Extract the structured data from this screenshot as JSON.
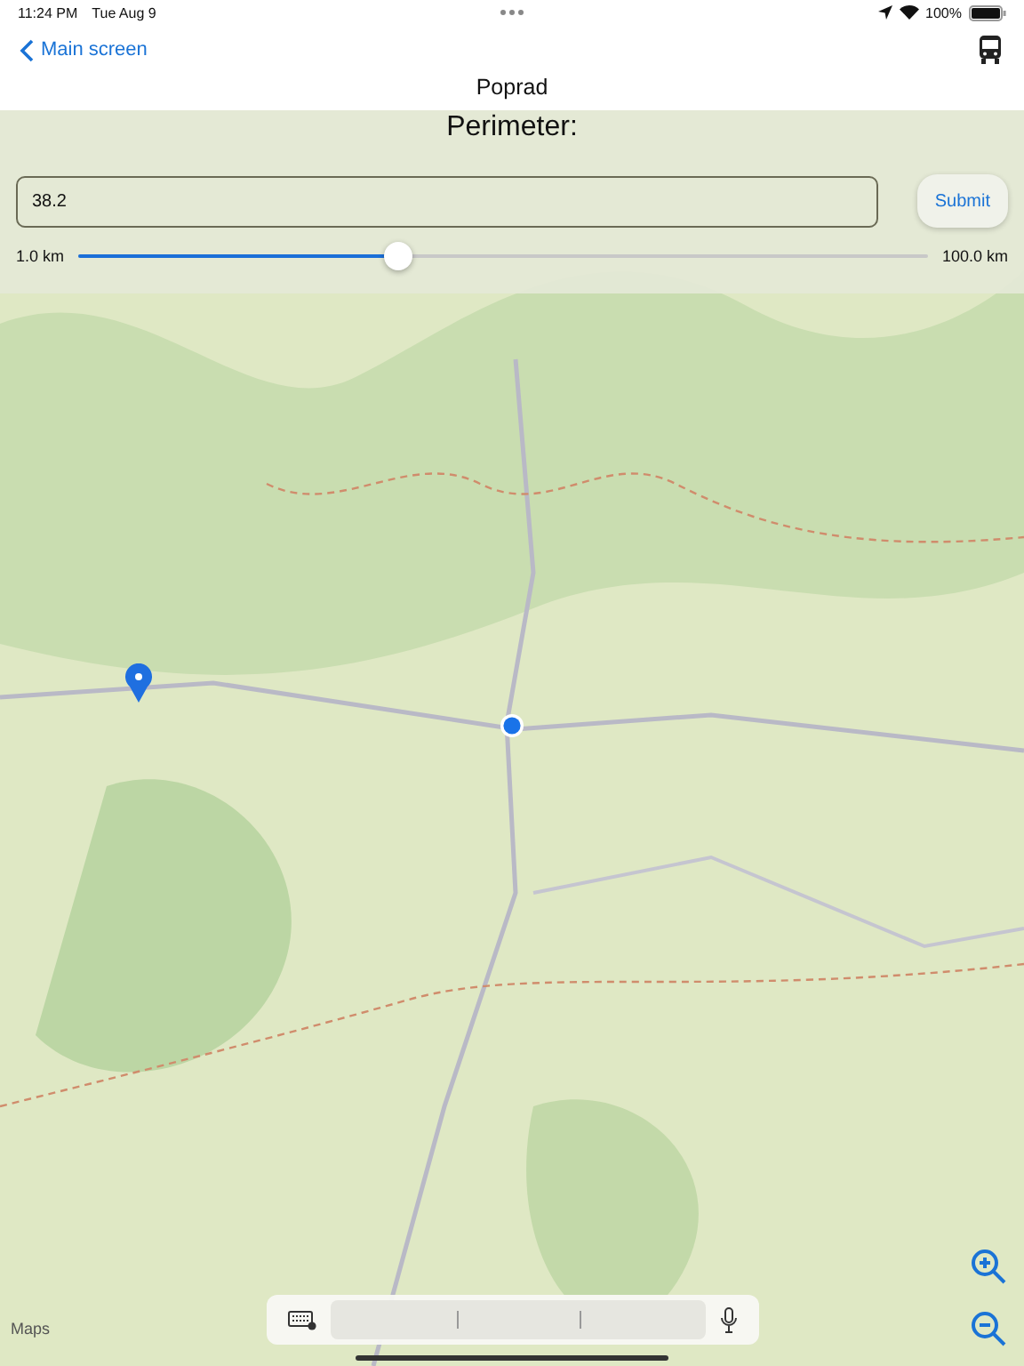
{
  "status_bar": {
    "time": "11:24 PM",
    "date": "Tue Aug 9",
    "battery": "100%"
  },
  "nav": {
    "back": "Main screen",
    "title": "Poprad"
  },
  "perimeter": {
    "heading": "Perimeter:",
    "value": "38.2",
    "submit": "Submit",
    "min_label": "1.0 km",
    "max_label": "100.0 km",
    "level": 0.376
  },
  "map": {
    "attribution": "Maps"
  }
}
